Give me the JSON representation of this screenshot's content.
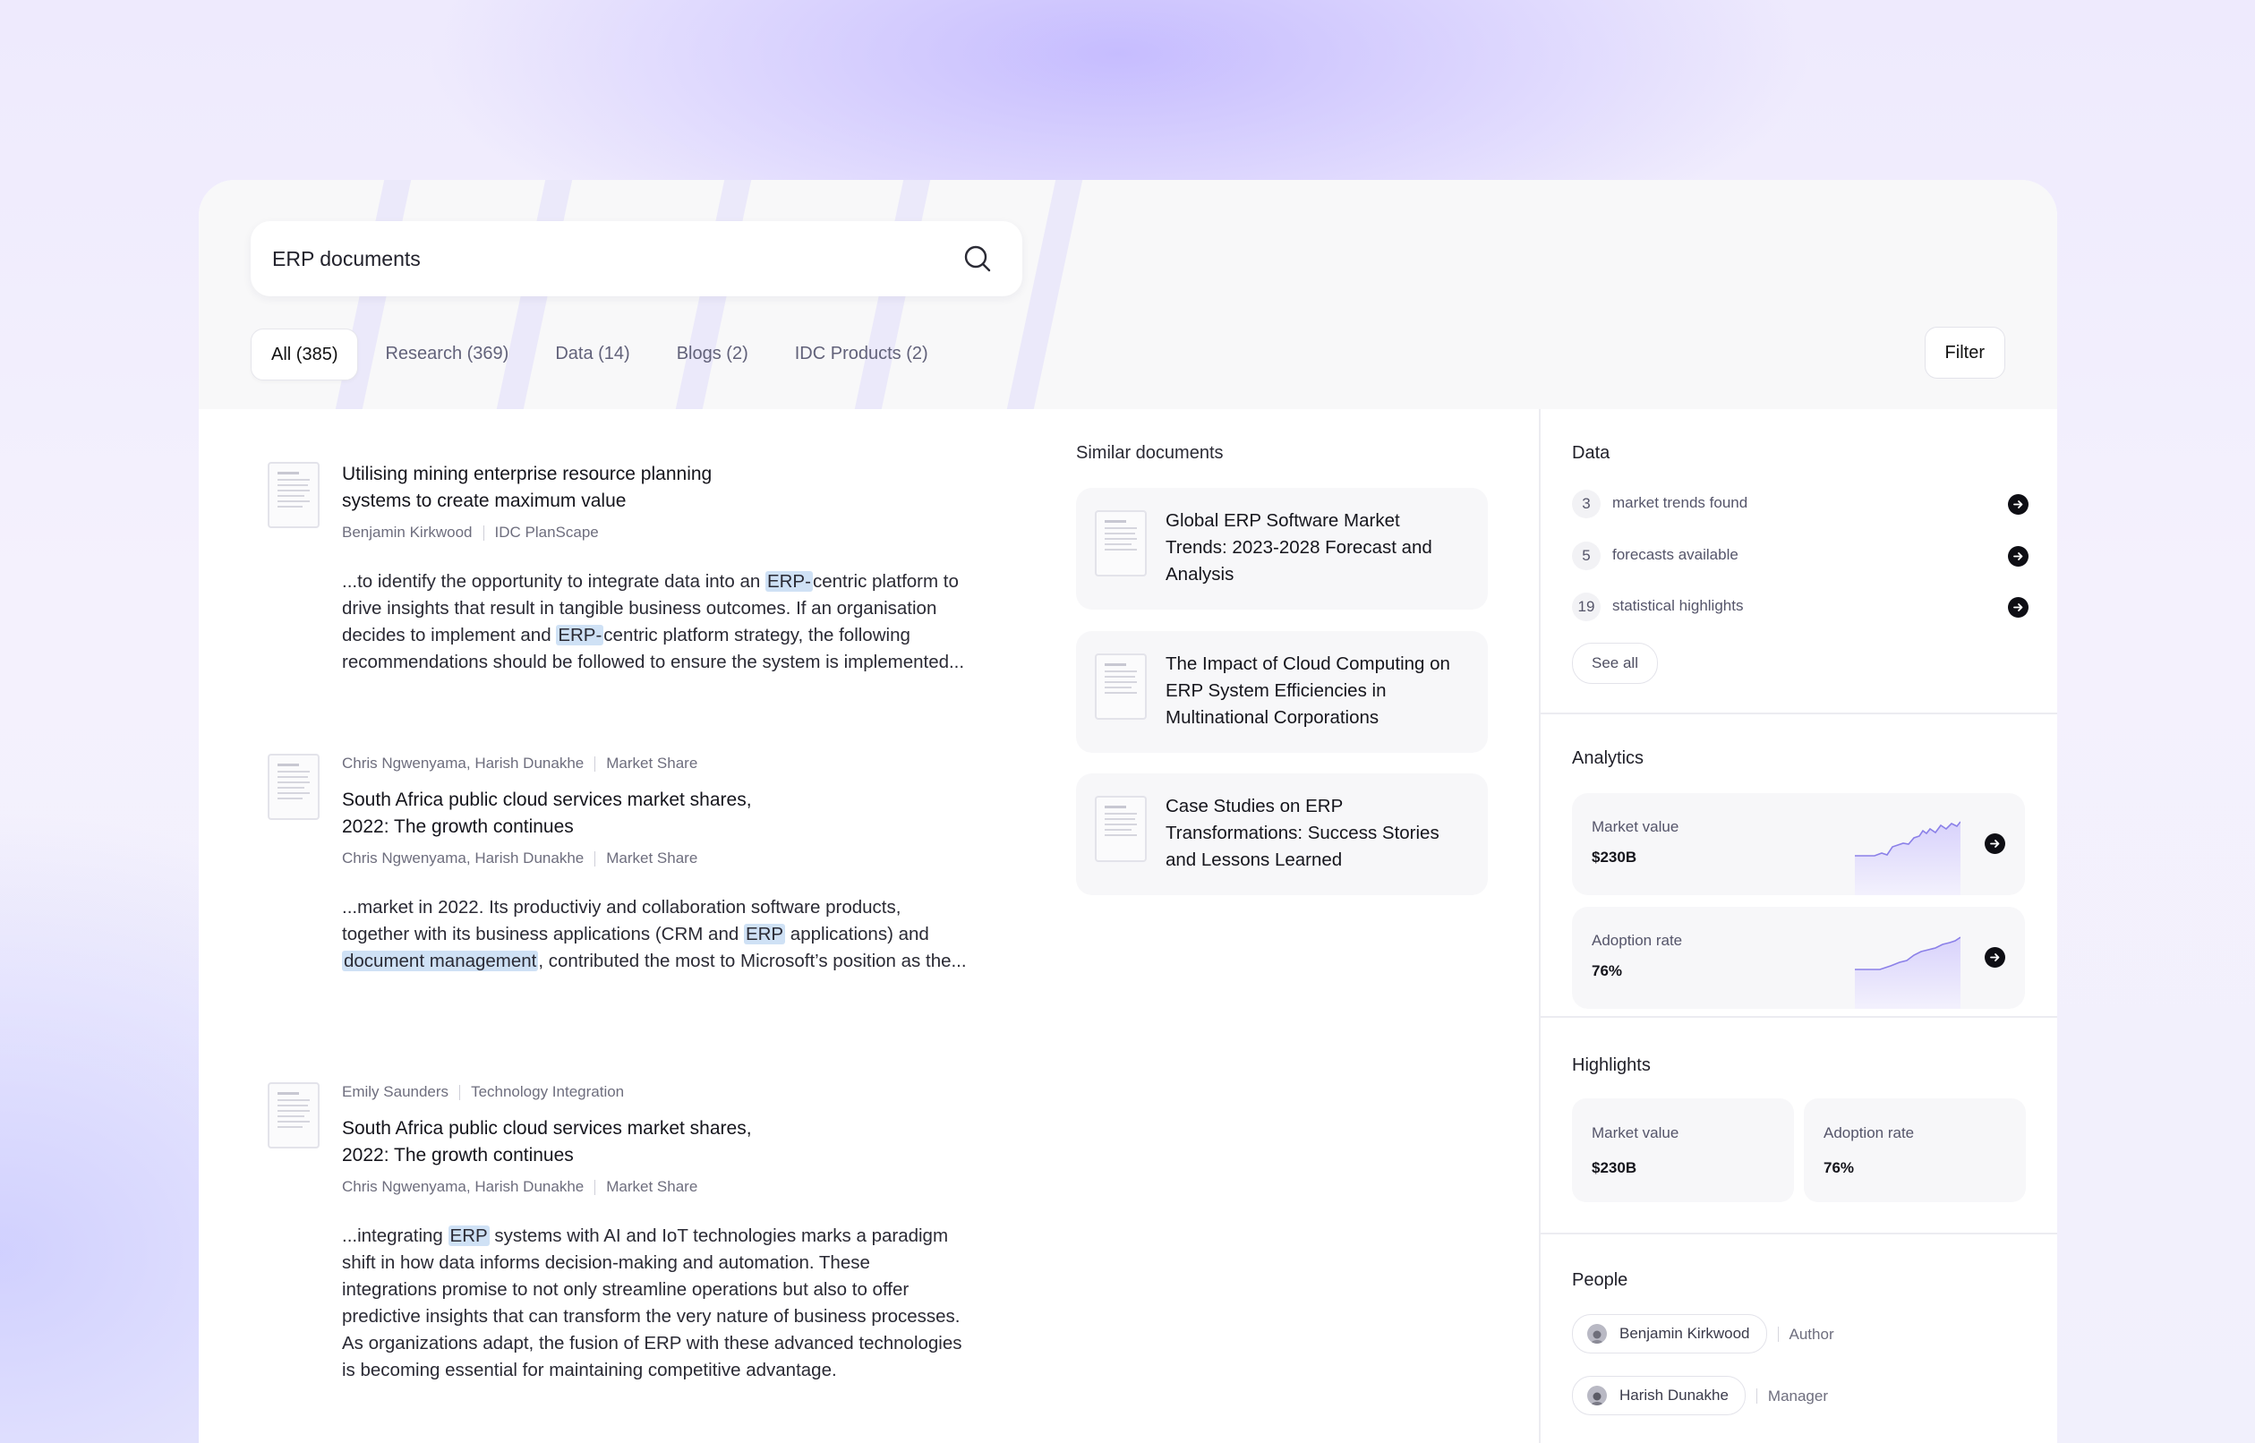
{
  "search": {
    "query": "ERP documents"
  },
  "tabs": [
    {
      "label": "All (385)"
    },
    {
      "label": "Research (369)"
    },
    {
      "label": "Data (14)"
    },
    {
      "label": "Blogs (2)"
    },
    {
      "label": "IDC Products (2)"
    }
  ],
  "filter_label": "Filter",
  "results": [
    {
      "title_lines": [
        "Utilising mining enterprise resource planning",
        "systems to create maximum value"
      ],
      "meta_bottom": [
        "Benjamin Kirkwood",
        "IDC PlanScape"
      ],
      "snippet": [
        [
          "...to identify the opportunity to integrate data into an ",
          "ERP-",
          "centric platform to"
        ],
        [
          "drive insights that result in tangible business outcomes. If an organisation"
        ],
        [
          "decides to implement and ",
          "ERP-",
          "centric platform strategy, the following"
        ],
        [
          "recommendations should be followed to ensure the system is implemented..."
        ]
      ]
    },
    {
      "meta_top": [
        "Chris Ngwenyama, Harish Dunakhe",
        "Market Share"
      ],
      "title_lines": [
        "South Africa public cloud services market shares,",
        "2022: The growth continues"
      ],
      "meta_bottom": [
        "Chris Ngwenyama, Harish Dunakhe",
        "Market Share"
      ],
      "snippet": [
        [
          "...market in 2022. Its productiviy and collaboration software products,"
        ],
        [
          "together with its business applications (CRM and ",
          "ERP",
          " applications) and"
        ],
        [
          "",
          "document management",
          ", contributed the most to Microsoft’s position as the..."
        ]
      ]
    },
    {
      "meta_top": [
        "Emily Saunders",
        "Technology Integration"
      ],
      "title_lines": [
        "South Africa public cloud services market shares,",
        "2022: The growth continues"
      ],
      "meta_bottom": [
        "Chris Ngwenyama, Harish Dunakhe",
        "Market Share"
      ],
      "snippet": [
        [
          "...integrating ",
          "ERP",
          " systems with AI and IoT technologies marks a paradigm"
        ],
        [
          "shift in how data informs decision-making and automation. These"
        ],
        [
          "integrations promise to not only streamline operations but also to offer"
        ],
        [
          "predictive insights that can transform the very nature of business processes."
        ],
        [
          "As organizations adapt, the fusion of ERP with these advanced technologies"
        ],
        [
          "is becoming essential for maintaining competitive advantage."
        ]
      ]
    }
  ],
  "similar": {
    "heading": "Similar documents",
    "items": [
      {
        "title_lines": [
          "Global ERP Software Market",
          "Trends: 2023-2028 Forecast and",
          "Analysis"
        ]
      },
      {
        "title_lines": [
          "The Impact of Cloud Computing on",
          "ERP System Efficiencies in",
          "Multinational Corporations"
        ]
      },
      {
        "title_lines": [
          "Case Studies on ERP",
          "Transformations: Success Stories",
          "and Lessons Learned"
        ]
      }
    ]
  },
  "sidebar": {
    "data": {
      "heading": "Data",
      "rows": [
        {
          "count": "3",
          "label": "market trends found"
        },
        {
          "count": "5",
          "label": "forecasts available"
        },
        {
          "count": "19",
          "label": "statistical highlights"
        }
      ],
      "see_all": "See all"
    },
    "analytics": {
      "heading": "Analytics",
      "cards": [
        {
          "label": "Market value",
          "value": "$230B"
        },
        {
          "label": "Adoption rate",
          "value": "76%"
        }
      ]
    },
    "highlights": {
      "heading": "Highlights",
      "cards": [
        {
          "label": "Market value",
          "value": "$230B"
        },
        {
          "label": "Adoption rate",
          "value": "76%"
        }
      ]
    },
    "people": {
      "heading": "People",
      "items": [
        {
          "name": "Benjamin Kirkwood",
          "role": "Author"
        },
        {
          "name": "Harish Dunakhe",
          "role": "Manager"
        }
      ]
    }
  }
}
